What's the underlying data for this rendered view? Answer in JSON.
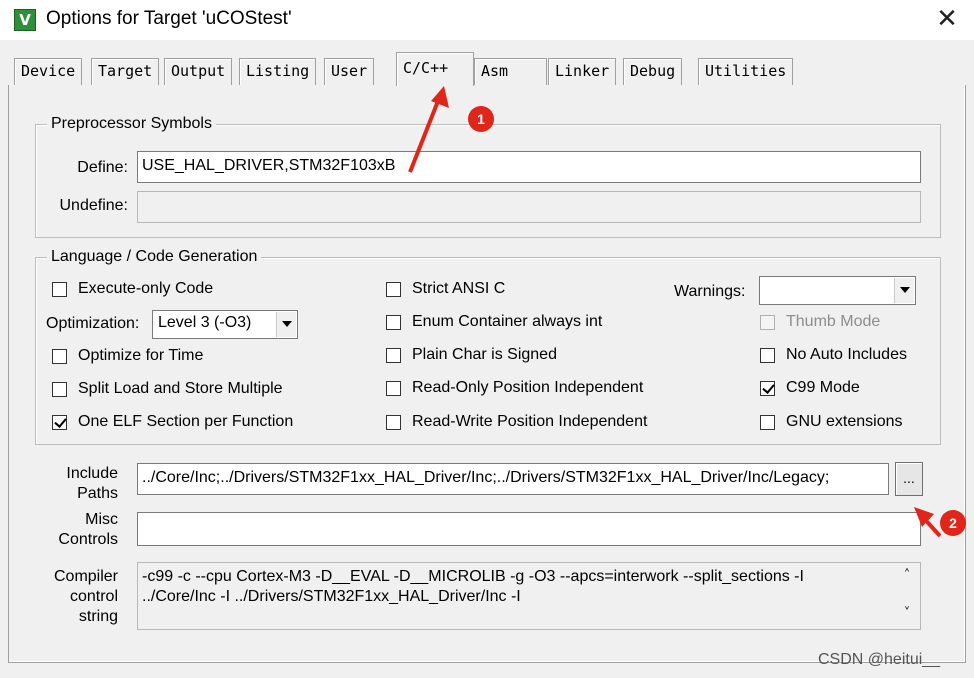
{
  "window": {
    "title": "Options for Target 'uCOStest'",
    "app_icon_glyph": "V",
    "close_glyph": "✕"
  },
  "tabs": [
    {
      "label": "Device",
      "active": false
    },
    {
      "label": "Target",
      "active": false
    },
    {
      "label": "Output",
      "active": false
    },
    {
      "label": "Listing",
      "active": false
    },
    {
      "label": "User",
      "active": false
    },
    {
      "label": "C/C++",
      "active": true
    },
    {
      "label": "Asm",
      "active": false
    },
    {
      "label": "Linker",
      "active": false
    },
    {
      "label": "Debug",
      "active": false
    },
    {
      "label": "Utilities",
      "active": false
    }
  ],
  "preprocessor": {
    "legend": "Preprocessor Symbols",
    "define_label": "Define:",
    "define_value": "USE_HAL_DRIVER,STM32F103xB",
    "undefine_label": "Undefine:",
    "undefine_value": ""
  },
  "language": {
    "legend": "Language / Code Generation",
    "execute_only": {
      "label": "Execute-only Code",
      "checked": false
    },
    "optimization_label": "Optimization:",
    "optimization_value": "Level 3 (-O3)",
    "optimize_time": {
      "label": "Optimize for Time",
      "checked": false
    },
    "split_load": {
      "label": "Split Load and Store Multiple",
      "checked": false
    },
    "one_elf": {
      "label": "One ELF Section per Function",
      "checked": true
    },
    "strict_ansi": {
      "label": "Strict ANSI C",
      "checked": false
    },
    "enum_container": {
      "label": "Enum Container always int",
      "checked": false
    },
    "plain_char": {
      "label": "Plain Char is Signed",
      "checked": false
    },
    "ro_pi": {
      "label": "Read-Only Position Independent",
      "checked": false
    },
    "rw_pi": {
      "label": "Read-Write Position Independent",
      "checked": false
    },
    "warnings_label": "Warnings:",
    "warnings_value": "",
    "thumb_mode": {
      "label": "Thumb Mode",
      "checked": false,
      "disabled": true
    },
    "no_auto_includes": {
      "label": "No Auto Includes",
      "checked": false
    },
    "c99_mode": {
      "label": "C99 Mode",
      "checked": true
    },
    "gnu_extensions": {
      "label": "GNU extensions",
      "checked": false
    }
  },
  "include": {
    "label_line1": "Include",
    "label_line2": "Paths",
    "value": "../Core/Inc;../Drivers/STM32F1xx_HAL_Driver/Inc;../Drivers/STM32F1xx_HAL_Driver/Inc/Legacy;",
    "browse_label": "..."
  },
  "misc": {
    "label_line1": "Misc",
    "label_line2": "Controls",
    "value": ""
  },
  "compiler": {
    "label_line1": "Compiler",
    "label_line2": "control",
    "label_line3": "string",
    "line1": "-c99 -c --cpu Cortex-M3 -D__EVAL -D__MICROLIB -g -O3 --apcs=interwork --split_sections -I",
    "line2": "../Core/Inc -I ../Drivers/STM32F1xx_HAL_Driver/Inc -I"
  },
  "annotations": {
    "badge1": "1",
    "badge2": "2",
    "color": "#e0251b"
  },
  "watermark": "CSDN @heitui__"
}
